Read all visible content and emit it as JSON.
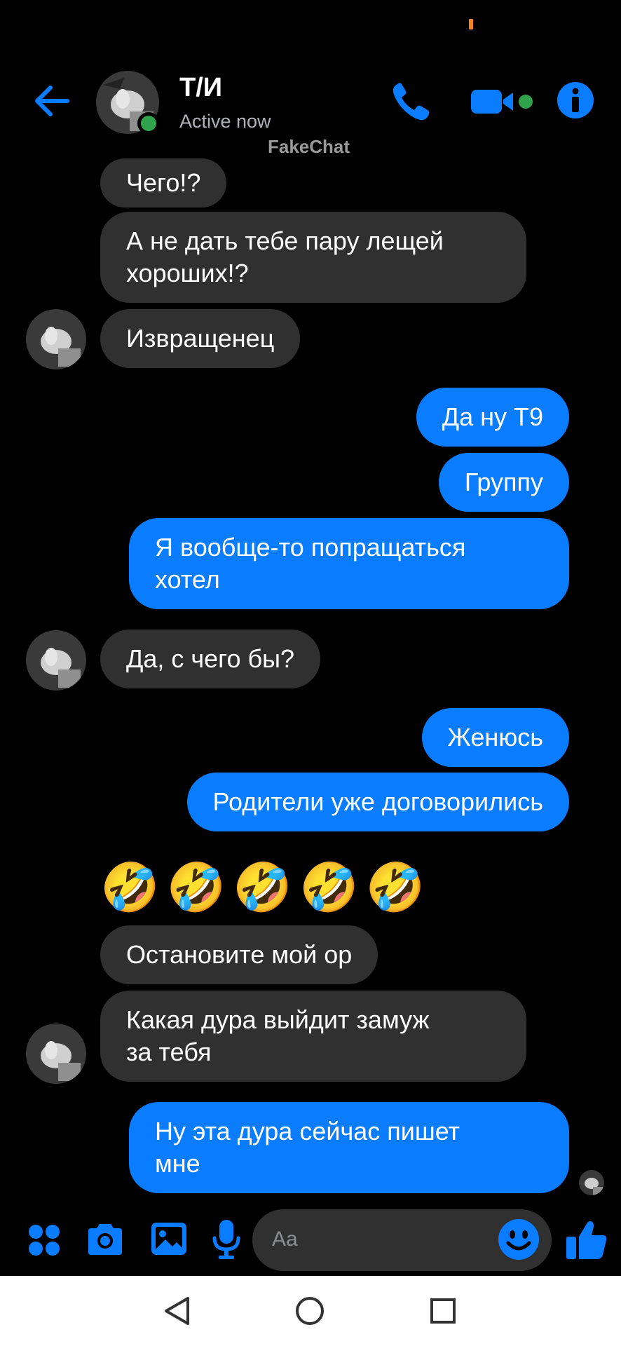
{
  "header": {
    "contact_name": "Т/И",
    "status": "Active now",
    "watermark": "FakeChat"
  },
  "messages": [
    {
      "from": "them",
      "text": "Чего!?"
    },
    {
      "from": "them",
      "text": "А не дать тебе пару лещей\nхороших!?"
    },
    {
      "from": "them",
      "text": "Извращенец"
    },
    {
      "from": "me",
      "text": "Да ну Т9"
    },
    {
      "from": "me",
      "text": "Группу"
    },
    {
      "from": "me",
      "text": "Я вообще-то попращаться\nхотел"
    },
    {
      "from": "them",
      "text": "Да, с чего бы?"
    },
    {
      "from": "me",
      "text": "Женюсь"
    },
    {
      "from": "me",
      "text": "Родители уже договорились"
    },
    {
      "from": "them",
      "text": "🤣🤣🤣🤣🤣"
    },
    {
      "from": "them",
      "text": "Остановите мой ор"
    },
    {
      "from": "them",
      "text": "Какая дура выйдит замуж\nза тебя"
    },
    {
      "from": "me",
      "text": "Ну эта дура сейчас пишет\nмне"
    }
  ],
  "composer": {
    "placeholder": "Aa",
    "tools": [
      "apps-icon",
      "camera-icon",
      "gallery-icon",
      "microphone-icon"
    ]
  },
  "colors": {
    "accent": "#0a7cff",
    "incoming_bubble": "#303030",
    "online": "#31a24c",
    "background": "#000000"
  }
}
